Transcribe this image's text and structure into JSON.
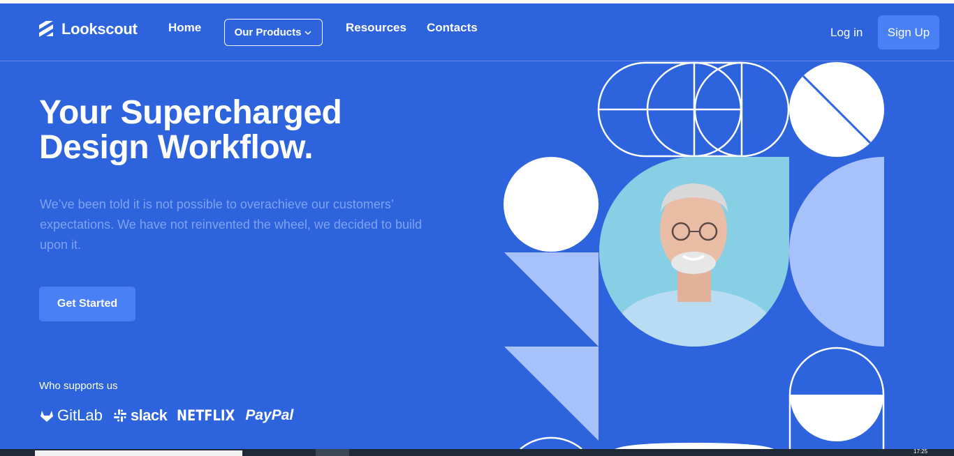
{
  "nav": {
    "brand": "Lookscout",
    "links": {
      "home": "Home",
      "products": "Our Products",
      "resources": "Resources",
      "contacts": "Contacts"
    },
    "login": "Log in",
    "signup": "Sign Up"
  },
  "hero": {
    "headline_line1": "Your Supercharged",
    "headline_line2": "Design Workflow.",
    "subtext": "We’ve been told it is not possible to overachieve our customers’ expectations. We have not reinvented the wheel, we decided to build upon it.",
    "cta": "Get Started",
    "supports_label": "Who supports us",
    "brands": {
      "gitlab": "GitLab",
      "slack": "slack",
      "netflix": "NETFLIX",
      "paypal": "PayPal"
    }
  },
  "colors": {
    "background": "#2d63dc",
    "button": "#4a80f5",
    "subtext": "#7fa3ef",
    "light_shape": "#a9c1fb",
    "photo_bg": "#8dd3e6"
  },
  "icons": [
    "lookscout-logo-icon",
    "chevron-down-icon",
    "gitlab-icon",
    "slack-icon"
  ],
  "taskbar": {
    "clock": "17:25"
  }
}
